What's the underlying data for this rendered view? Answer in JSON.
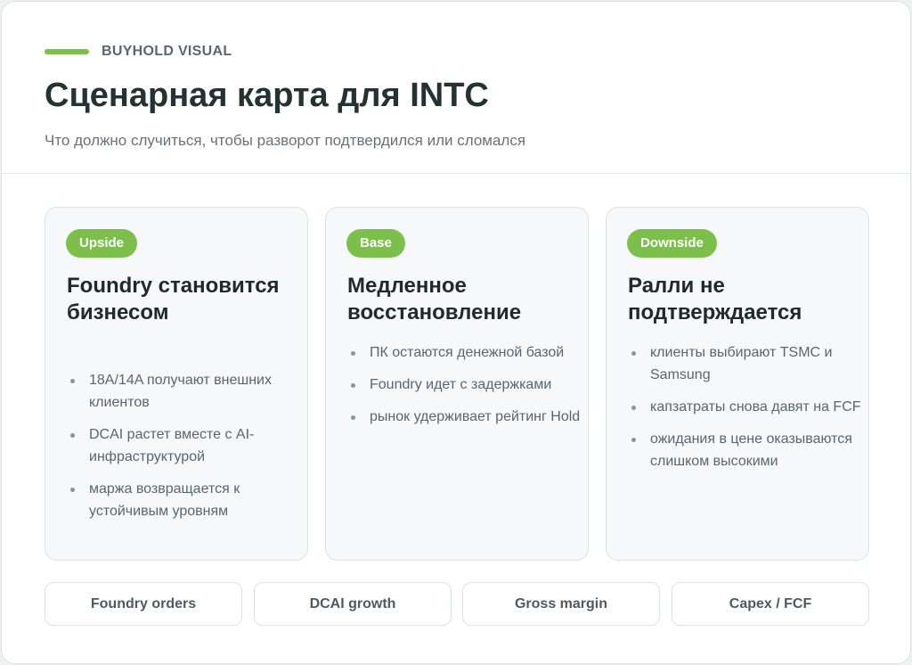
{
  "header": {
    "brand": "BUYHOLD VISUAL",
    "title": "Сценарная карта для INTC",
    "subtitle": "Что должно случиться, чтобы разворот подтвердился или сломался"
  },
  "scenarios": [
    {
      "badge": "Upside",
      "title": "Foundry становится бизнесом",
      "bullets": [
        "18A/14A получают внешних клиентов",
        "DCAI растет вместе с AI-инфраструктурой",
        "маржа возвращается к устойчивым уровням"
      ]
    },
    {
      "badge": "Base",
      "title": "Медленное восстановление",
      "bullets": [
        "ПК остаются денежной базой",
        "Foundry идет с задержками",
        "рынок удерживает рейтинг Hold"
      ]
    },
    {
      "badge": "Downside",
      "title": "Ралли не подтверждается",
      "bullets": [
        "клиенты выбирают TSMC и Samsung",
        "капзатраты снова давят на FCF",
        "ожидания в цене оказываются слишком высокими"
      ]
    }
  ],
  "metrics": [
    "Foundry orders",
    "DCAI growth",
    "Gross margin",
    "Capex / FCF"
  ],
  "colors": {
    "accent": "#7cc04b",
    "card_bg": "#f6f8fa",
    "border": "#dde2e6"
  }
}
